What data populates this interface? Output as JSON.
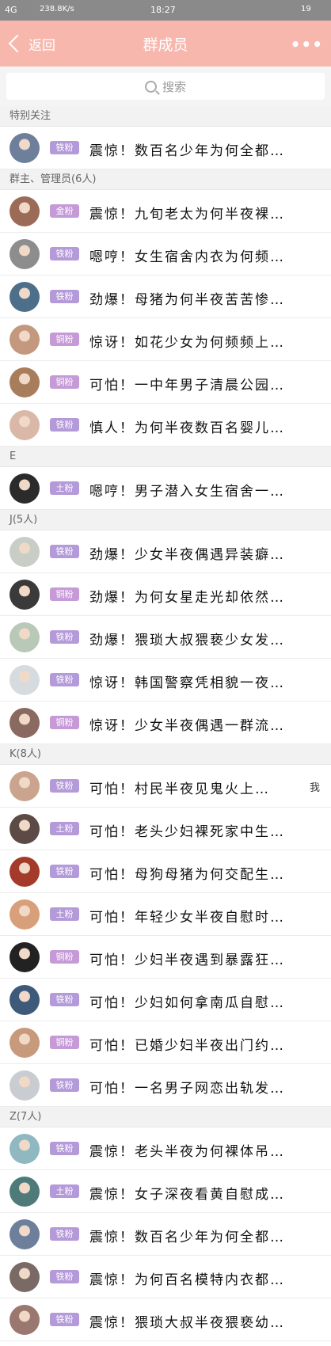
{
  "status_bar": {
    "network": "4G",
    "speed": "238.8K/s",
    "time": "18:27",
    "battery": "19"
  },
  "nav": {
    "back_label": "返回",
    "title": "群成员",
    "more_label": "•••"
  },
  "search": {
    "placeholder": "搜索"
  },
  "colors": {
    "nav_bg": "#f7b7ad",
    "badge_purple": "#b49ad8",
    "badge_gold": "#c59ad6"
  },
  "sections": [
    {
      "header": "特别关注",
      "members": [
        {
          "badge": "铁粉",
          "name": "震惊！数百名少年为何全都…",
          "avatar": "#6d7f9a"
        }
      ]
    },
    {
      "header": "群主、管理员(6人)",
      "members": [
        {
          "badge": "金粉",
          "name": "震惊！九旬老太为何半夜裸…",
          "avatar": "#9c6b58"
        },
        {
          "badge": "铁粉",
          "name": "嗯哼！女生宿舍内衣为何频…",
          "avatar": "#8d8d8d"
        },
        {
          "badge": "铁粉",
          "name": "劲爆！母猪为何半夜苦苦惨…",
          "avatar": "#4d6f8a"
        },
        {
          "badge": "铜粉",
          "name": "惊讶！如花少女为何频频上…",
          "avatar": "#c4987e"
        },
        {
          "badge": "铜粉",
          "name": "可怕！一中年男子清晨公园…",
          "avatar": "#a87d5c"
        },
        {
          "badge": "铁粉",
          "name": "慎人！为何半夜数百名婴儿…",
          "avatar": "#d9b8a8"
        }
      ]
    },
    {
      "header": "E",
      "members": [
        {
          "badge": "土粉",
          "name": "嗯哼！男子潜入女生宿舍一…",
          "avatar": "#2b2b2b"
        }
      ]
    },
    {
      "header": "J(5人)",
      "members": [
        {
          "badge": "铁粉",
          "name": "劲爆！少女半夜偶遇异装癖…",
          "avatar": "#c8cdc6"
        },
        {
          "badge": "铜粉",
          "name": "劲爆！为何女星走光却依然…",
          "avatar": "#3a3a3a"
        },
        {
          "badge": "铁粉",
          "name": "劲爆！猥琐大叔猥亵少女发…",
          "avatar": "#b9c9b8"
        },
        {
          "badge": "铁粉",
          "name": "惊讶！韩国警察凭相貌一夜…",
          "avatar": "#d6dbe0"
        },
        {
          "badge": "铜粉",
          "name": "惊讶！少女半夜偶遇一群流…",
          "avatar": "#8a6a60"
        }
      ]
    },
    {
      "header": "K(8人)",
      "members": [
        {
          "badge": "铁粉",
          "name": "可怕！村民半夜见鬼火上…",
          "avatar": "#caa48e",
          "side": "我"
        },
        {
          "badge": "土粉",
          "name": "可怕！老头少妇裸死家中生…",
          "avatar": "#5b4a45"
        },
        {
          "badge": "铁粉",
          "name": "可怕！母狗母猪为何交配生…",
          "avatar": "#a33a2a"
        },
        {
          "badge": "土粉",
          "name": "可怕！年轻少女半夜自慰时…",
          "avatar": "#d8a07a"
        },
        {
          "badge": "铜粉",
          "name": "可怕！少妇半夜遇到暴露狂…",
          "avatar": "#222222"
        },
        {
          "badge": "铁粉",
          "name": "可怕！少妇如何拿南瓜自慰…",
          "avatar": "#3e5a7a"
        },
        {
          "badge": "铜粉",
          "name": "可怕！已婚少妇半夜出门约…",
          "avatar": "#c69a7a"
        },
        {
          "badge": "铁粉",
          "name": "可怕！一名男子网恋出轨发…",
          "avatar": "#c9ccd0"
        }
      ]
    },
    {
      "header": "Z(7人)",
      "members": [
        {
          "badge": "铁粉",
          "name": "震惊！老头半夜为何裸体吊…",
          "avatar": "#8fb8c0"
        },
        {
          "badge": "土粉",
          "name": "震惊！女子深夜看黄自慰成…",
          "avatar": "#4f7a7a"
        },
        {
          "badge": "铁粉",
          "name": "震惊！数百名少年为何全都…",
          "avatar": "#6d7f9a"
        },
        {
          "badge": "铁粉",
          "name": "震惊！为何百名模特内衣都…",
          "avatar": "#7a6a66"
        },
        {
          "badge": "铁粉",
          "name": "震惊！猥琐大叔半夜猥亵幼…",
          "avatar": "#9a7870"
        }
      ]
    }
  ]
}
